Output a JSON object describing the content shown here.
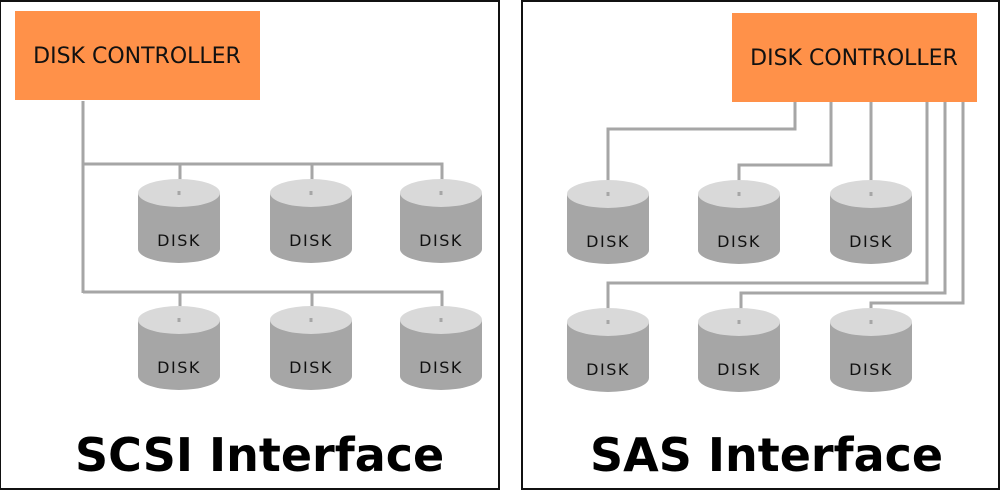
{
  "colors": {
    "controller_fill": "#ff9149",
    "disk_top": "#d9d9d9",
    "disk_body": "#a6a6a6",
    "wire": "#a6a6a6",
    "border": "#111111"
  },
  "panels": [
    {
      "id": "scsi",
      "title": "SCSI Interface",
      "controller_label": "DISK CONTROLLER",
      "topology": "shared-bus",
      "disks": [
        "DISK",
        "DISK",
        "DISK",
        "DISK",
        "DISK",
        "DISK"
      ]
    },
    {
      "id": "sas",
      "title": "SAS Interface",
      "controller_label": "DISK CONTROLLER",
      "topology": "point-to-point",
      "disks": [
        "DISK",
        "DISK",
        "DISK",
        "DISK",
        "DISK",
        "DISK"
      ]
    }
  ]
}
